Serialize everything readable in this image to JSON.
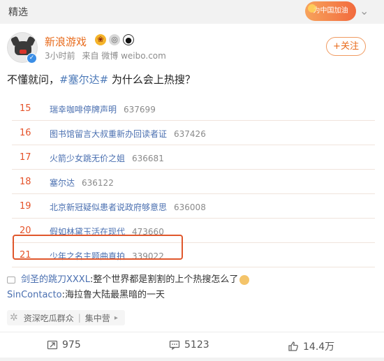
{
  "topbar": {
    "label": "精选",
    "badge": "为中国加油"
  },
  "post": {
    "username": "新浪游戏",
    "time": "3小时前",
    "source": "来自 微博 weibo.com",
    "follow_label": "+关注",
    "text_before": "不懂就问，",
    "hashtag": "#塞尔达#",
    "text_after": " 为什么会上热搜？"
  },
  "hot_list": [
    {
      "rank": "15",
      "title": "瑞幸咖啡停牌声明",
      "count": "637699"
    },
    {
      "rank": "16",
      "title": "图书馆留言大叔重新办回读者证",
      "count": "637426"
    },
    {
      "rank": "17",
      "title": "火箭少女跳无价之姐",
      "count": "636681"
    },
    {
      "rank": "18",
      "title": "塞尔达",
      "count": "636122"
    },
    {
      "rank": "19",
      "title": "北京新冠疑似患者说政府够意思",
      "count": "636008"
    },
    {
      "rank": "20",
      "title": "假如林黛玉活在现代",
      "count": "473660"
    },
    {
      "rank": "21",
      "title": "少年之名主题曲直拍",
      "count": "339022"
    }
  ],
  "comments": [
    {
      "name": "剑圣的跳刀XXXL",
      "text": ":整个世界都是割割的上个热搜怎么了"
    },
    {
      "name": "SinContacto",
      "text": ":海拉鲁大陆最黑暗的一天"
    }
  ],
  "group": {
    "name": "资深吃瓜群众",
    "sep": "|",
    "camp": "集中营"
  },
  "actions": {
    "repost": "975",
    "comment": "5123",
    "like": "14.4万"
  },
  "colors": {
    "accent": "#e86b1c",
    "link": "#4a6fb0",
    "rank": "#e5532a",
    "highlight_border": "#e0572c"
  }
}
